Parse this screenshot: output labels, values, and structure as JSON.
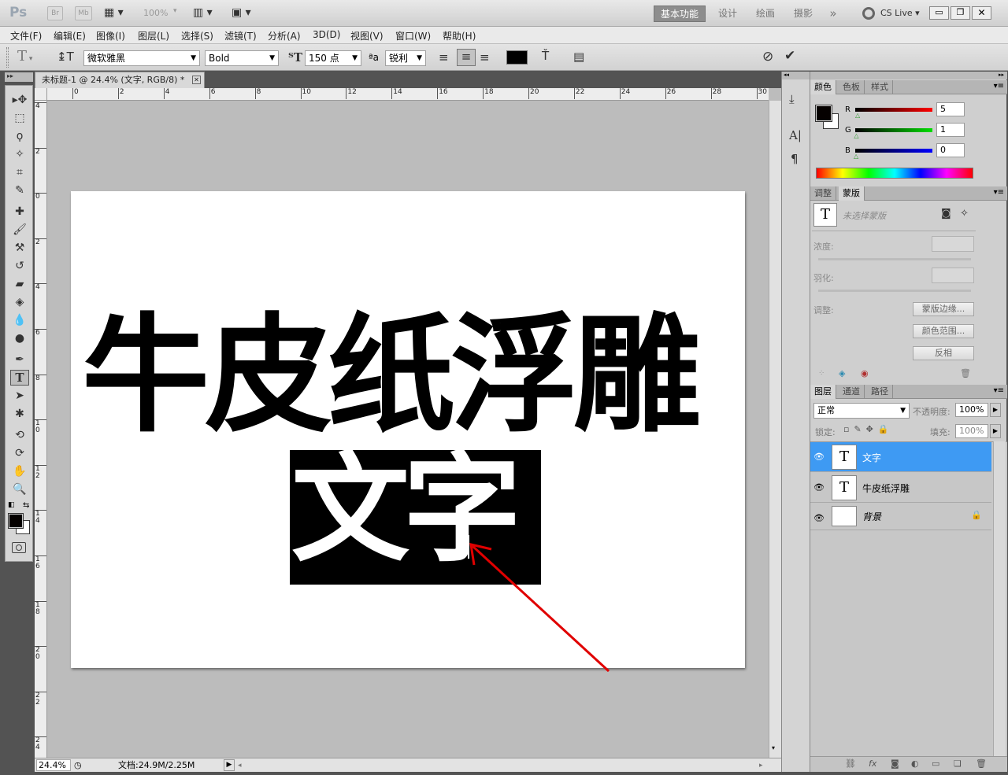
{
  "app": {
    "logo": "Ps",
    "bridge": "Br",
    "minibridge": "Mb",
    "zoom_select": "100%",
    "workspaces": [
      "基本功能",
      "设计",
      "绘画",
      "摄影"
    ],
    "more": "»",
    "cslive": "CS Live",
    "window_controls": [
      "minimize",
      "restore",
      "close"
    ]
  },
  "menu": [
    "文件(F)",
    "编辑(E)",
    "图像(I)",
    "图层(L)",
    "选择(S)",
    "滤镜(T)",
    "分析(A)",
    "3D(D)",
    "视图(V)",
    "窗口(W)",
    "帮助(H)"
  ],
  "options": {
    "tool_glyph": "T",
    "font_family": "微软雅黑",
    "font_style": "Bold",
    "font_size": "150 点",
    "aa_label": "ªa",
    "antialias": "锐利"
  },
  "document": {
    "tab_title": "未标题-1 @ 24.4% (文字, RGB/8) *",
    "ruler_top": [
      "0",
      "2",
      "4",
      "6",
      "8",
      "10",
      "12",
      "14",
      "16",
      "18",
      "20",
      "22",
      "24",
      "26",
      "28",
      "30"
    ],
    "ruler_left": [
      "4",
      "2",
      "0",
      "2",
      "4",
      "6",
      "8",
      "1 0",
      "1 2",
      "1 4",
      "1 6",
      "1 8",
      "2 0",
      "2 2",
      "2 4"
    ],
    "main_text": "牛皮纸浮雕",
    "selected_text": "文字",
    "status_zoom": "24.4%",
    "status_doc": "文档:24.9M/2.25M"
  },
  "color_panel": {
    "tabs": [
      "颜色",
      "色板",
      "样式"
    ],
    "r_label": "R",
    "g_label": "G",
    "b_label": "B",
    "r": "5",
    "g": "1",
    "b": "0",
    "r_frac": 0.02,
    "g_frac": 0.004,
    "b_frac": 0.0
  },
  "mask_panel": {
    "tabs": [
      "调整",
      "蒙版"
    ],
    "no_mask": "未选择蒙版",
    "density": "浓度:",
    "feather": "羽化:",
    "refine": "调整:",
    "edge_btn": "蒙版边缘...",
    "range_btn": "颜色范围...",
    "invert_btn": "反相"
  },
  "layers_panel": {
    "tabs": [
      "图层",
      "通道",
      "路径"
    ],
    "blend_mode": "正常",
    "opacity_label": "不透明度:",
    "opacity": "100%",
    "lock_label": "锁定:",
    "fill_label": "填充:",
    "fill": "100%",
    "layers": [
      {
        "name": "文字",
        "thumb": "T",
        "selected": true
      },
      {
        "name": "牛皮纸浮雕",
        "thumb": "T",
        "selected": false
      },
      {
        "name": "背景",
        "thumb": "",
        "selected": false
      }
    ]
  },
  "colors": {
    "accent_selected_layer": "#3e9af3",
    "foreground": "#050100",
    "arrow": "#e00000"
  }
}
